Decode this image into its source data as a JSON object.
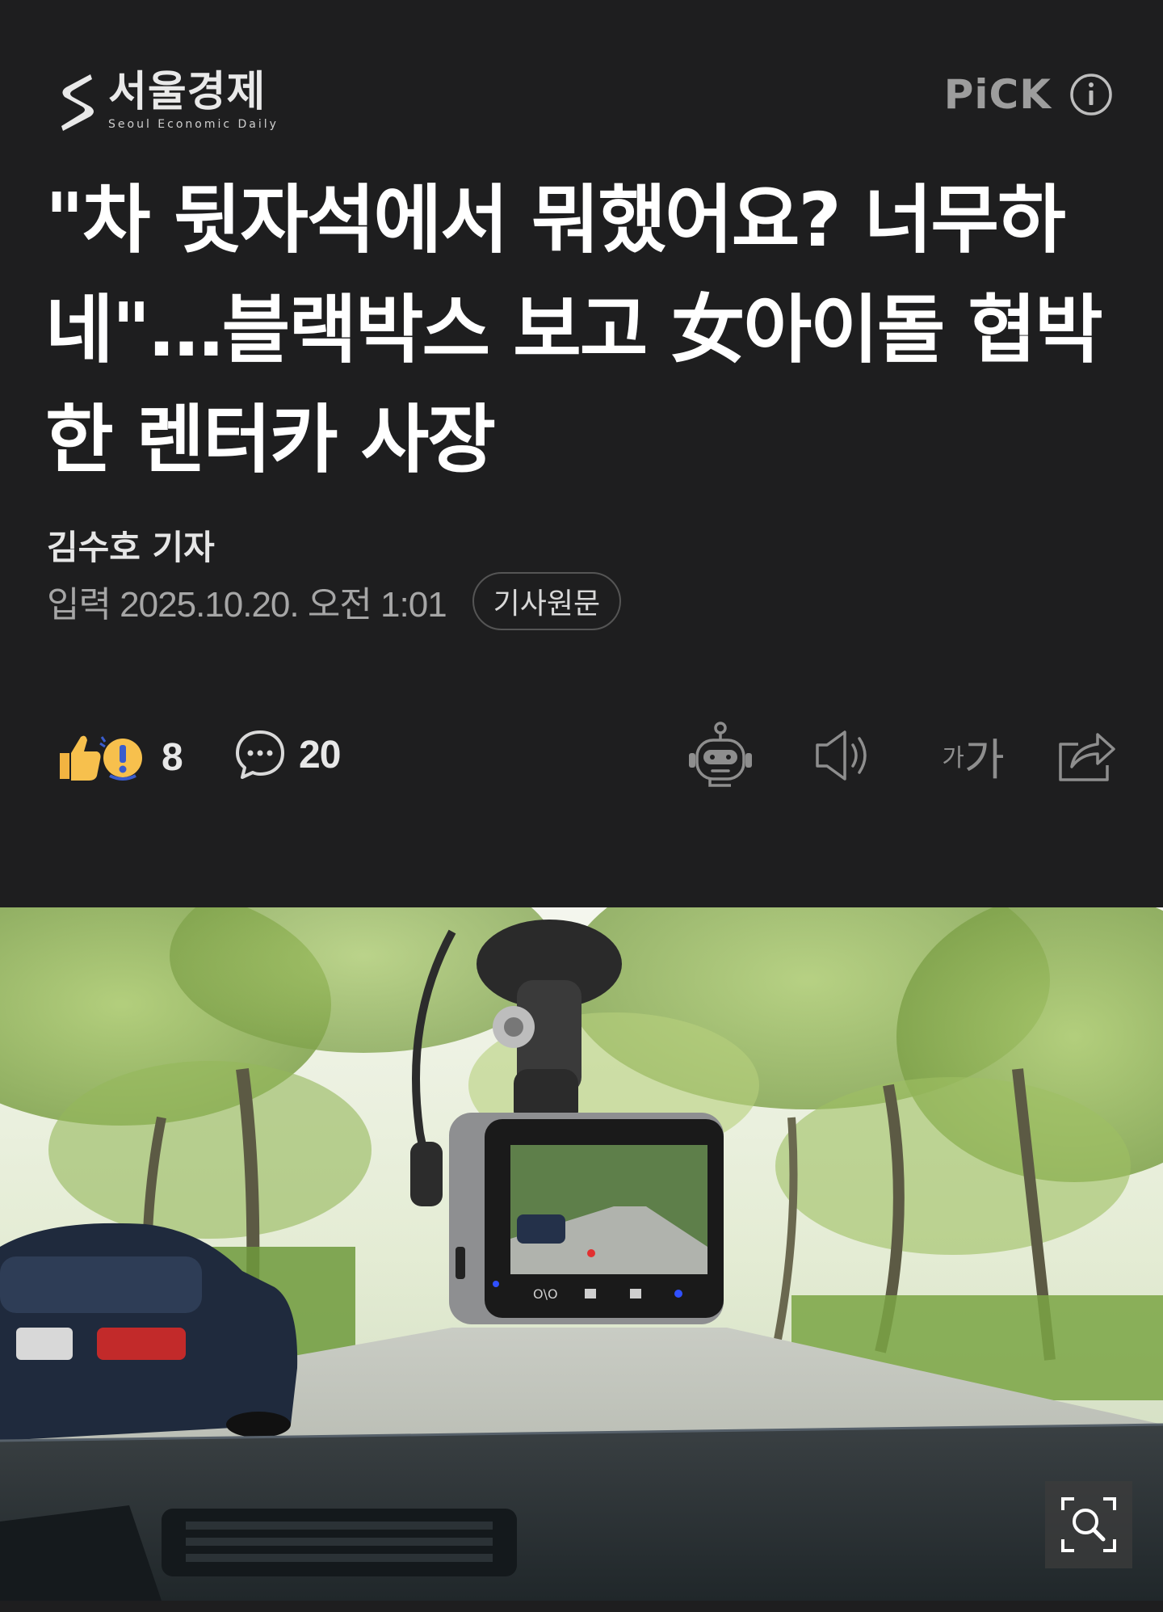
{
  "brand": {
    "name": "서울경제",
    "tagline": "Seoul Economic Daily"
  },
  "pick": {
    "label": "PiCK",
    "info_icon": "info-circle-icon"
  },
  "article": {
    "title": "\"차 뒷자석에서 뭐했어요? 너무하네\"…블랙박스 보고 女아이돌 협박한 렌터카 사장",
    "author": "김수호 기자",
    "date": "입력 2025.10.20. 오전 1:01",
    "source_button": "기사원문"
  },
  "actions": {
    "reaction_count": "8",
    "comment_count": "20",
    "icons": [
      "reaction-emoji-icon",
      "comment-bubble-icon",
      "ai-summary-robot-icon",
      "text-to-speech-speaker-icon",
      "font-size-icon",
      "share-icon"
    ],
    "font_size_small": "가",
    "font_size_big": "가"
  },
  "colors": {
    "background": "#1e1e1f",
    "title": "#ffffff",
    "muted": "#a6a6a6",
    "icon": "#8e8e8e"
  },
  "photo": {
    "description_icon": "dashcam-photo",
    "zoom_icon": "zoom-magnifier-icon"
  }
}
